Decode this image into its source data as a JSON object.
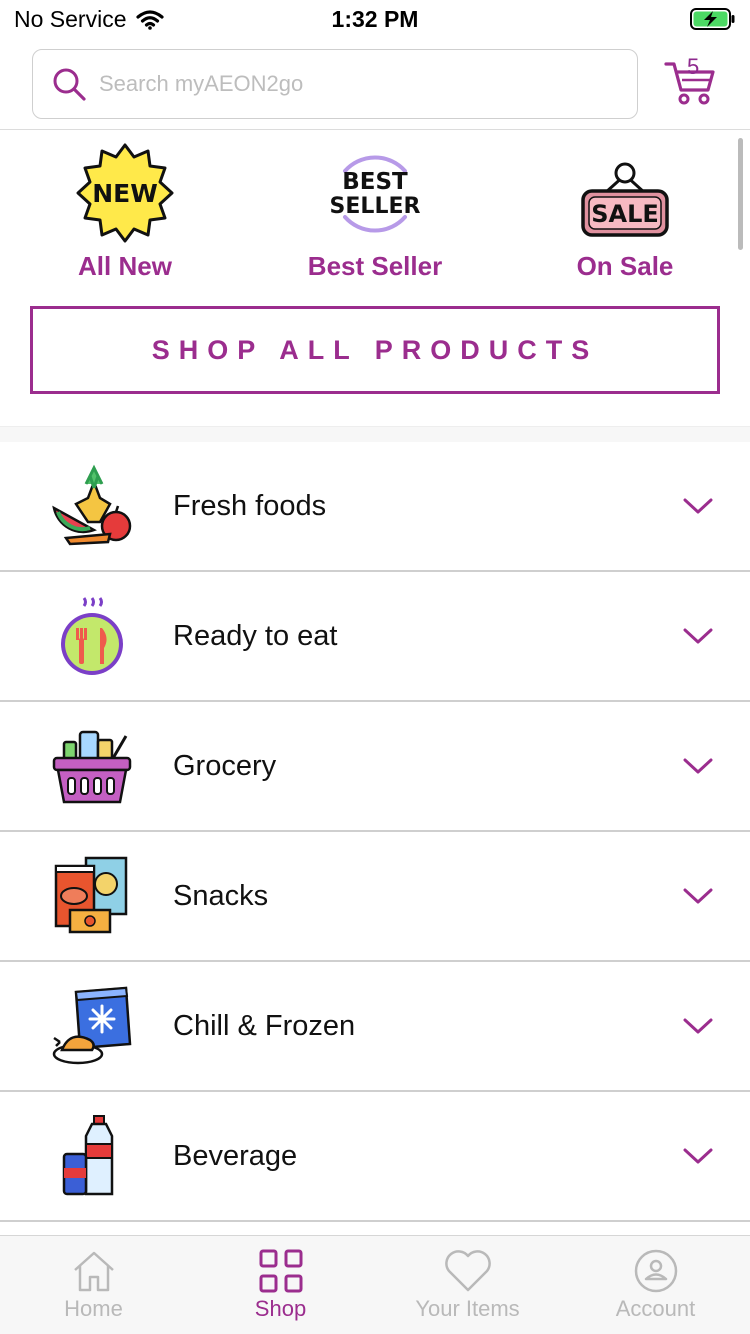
{
  "status_bar": {
    "carrier": "No Service",
    "time": "1:32 PM"
  },
  "search": {
    "placeholder": "Search myAEON2go"
  },
  "cart": {
    "count": "5"
  },
  "features": [
    {
      "label": "All New",
      "badge_line1": "NEW"
    },
    {
      "label": "Best Seller",
      "badge_line1": "BEST",
      "badge_line2": "SELLER"
    },
    {
      "label": "On Sale",
      "badge_line1": "SALE"
    }
  ],
  "shop_all": {
    "label": "SHOP ALL PRODUCTS"
  },
  "categories": [
    {
      "label": "Fresh foods",
      "icon": "fresh-foods-icon"
    },
    {
      "label": "Ready to eat",
      "icon": "ready-to-eat-icon"
    },
    {
      "label": "Grocery",
      "icon": "grocery-basket-icon"
    },
    {
      "label": "Snacks",
      "icon": "snacks-icon"
    },
    {
      "label": "Chill & Frozen",
      "icon": "chill-frozen-icon"
    },
    {
      "label": "Beverage",
      "icon": "beverage-icon"
    }
  ],
  "tabs": [
    {
      "label": "Home",
      "icon": "home-icon",
      "active": false
    },
    {
      "label": "Shop",
      "icon": "grid-icon",
      "active": true
    },
    {
      "label": "Your Items",
      "icon": "heart-icon",
      "active": false
    },
    {
      "label": "Account",
      "icon": "account-icon",
      "active": false
    }
  ],
  "colors": {
    "accent": "#9b2d8e",
    "inactive": "#b9b9b9",
    "divider": "#cfcfcf"
  }
}
